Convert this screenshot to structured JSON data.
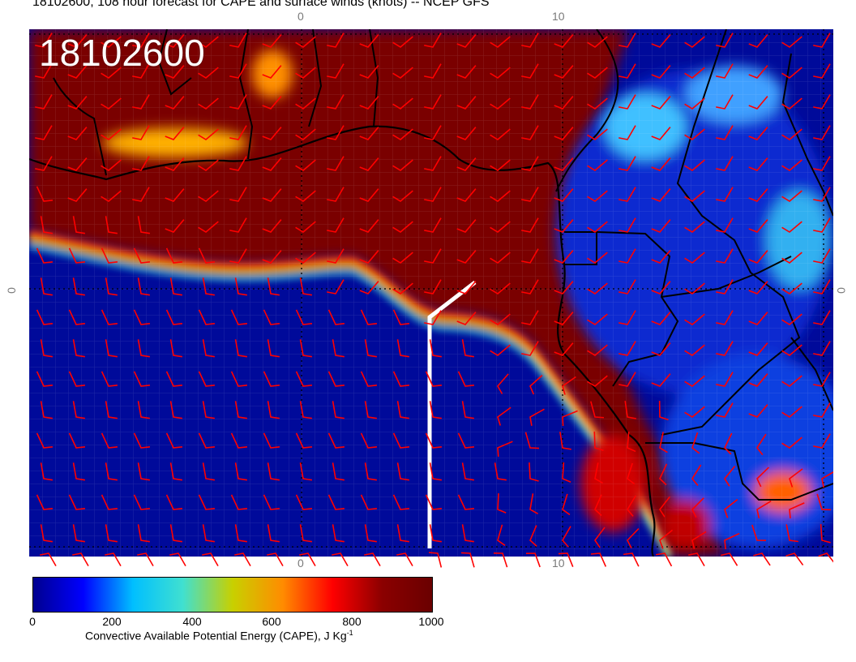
{
  "title": "18102600, 108 hour forecast for CAPE and surface winds (knots) -- NCEP GFS",
  "stamp": "18102600",
  "ticks": {
    "top_0": "0",
    "top_10": "10",
    "bottom_0": "0",
    "bottom_10": "10",
    "left_0": "0",
    "right_0": "0"
  },
  "colorbar": {
    "labels": [
      "0",
      "200",
      "400",
      "600",
      "800",
      "1000"
    ],
    "title": "Convective Available Potential Energy (CAPE), J Kg",
    "unit_superscript": "-1",
    "colors": [
      "#00008f",
      "#0000ff",
      "#00bfff",
      "#40e0d0",
      "#c8d000",
      "#ff8c00",
      "#ff0000",
      "#8b0000",
      "#6a0000"
    ]
  },
  "colors": {
    "high_cape": "#7a0000",
    "low_cape": "#000a9a",
    "wind_barb": "#ff0000",
    "transect": "#ffffff",
    "coastline": "#000000"
  }
}
